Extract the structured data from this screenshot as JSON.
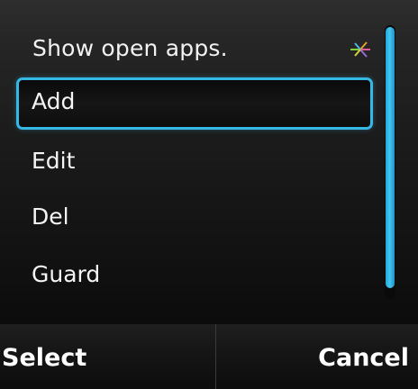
{
  "menu": {
    "title": "Show open apps.",
    "title_icon": "activity-indicator-icon",
    "items": [
      {
        "label": "Add",
        "selected": true
      },
      {
        "label": "Edit",
        "selected": false
      },
      {
        "label": "Del",
        "selected": false
      },
      {
        "label": "Guard",
        "selected": false
      }
    ]
  },
  "softkeys": {
    "left_label": "Select",
    "right_label": "Cancel"
  },
  "colors": {
    "highlight": "#35b8e6",
    "scrollbar": "#2ab6e8",
    "background": "#000000",
    "text": "#ffffff"
  }
}
